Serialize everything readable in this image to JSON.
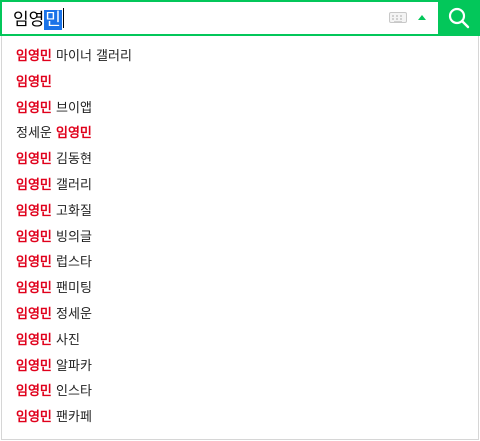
{
  "search": {
    "query_prefix": "임영",
    "query_highlight": "민",
    "keyboard_icon": "keyboard-icon",
    "toggle_icon": "triangle-up-icon",
    "button_icon": "magnifier-icon",
    "accent_color": "#03c75a",
    "highlight_color": "#e0001b"
  },
  "suggestions": [
    {
      "pre": "",
      "match": "임영민",
      "post": " 마이너 갤러리"
    },
    {
      "pre": "",
      "match": "임영민",
      "post": ""
    },
    {
      "pre": "",
      "match": "임영민",
      "post": " 브이앱"
    },
    {
      "pre": "정세운 ",
      "match": "임영민",
      "post": ""
    },
    {
      "pre": "",
      "match": "임영민",
      "post": " 김동현"
    },
    {
      "pre": "",
      "match": "임영민",
      "post": " 갤러리"
    },
    {
      "pre": "",
      "match": "임영민",
      "post": " 고화질"
    },
    {
      "pre": "",
      "match": "임영민",
      "post": " 빙의글"
    },
    {
      "pre": "",
      "match": "임영민",
      "post": " 럽스타"
    },
    {
      "pre": "",
      "match": "임영민",
      "post": " 팬미팅"
    },
    {
      "pre": "",
      "match": "임영민",
      "post": " 정세운"
    },
    {
      "pre": "",
      "match": "임영민",
      "post": " 사진"
    },
    {
      "pre": "",
      "match": "임영민",
      "post": " 알파카"
    },
    {
      "pre": "",
      "match": "임영민",
      "post": " 인스타"
    },
    {
      "pre": "",
      "match": "임영민",
      "post": " 팬카페"
    }
  ]
}
